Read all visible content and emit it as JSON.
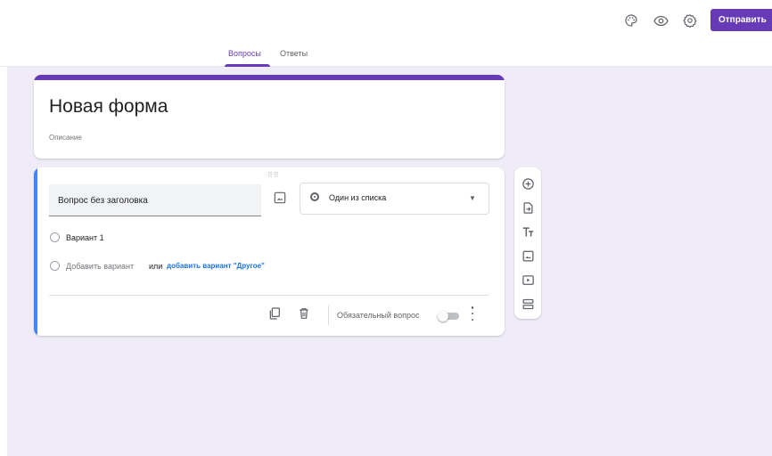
{
  "header": {
    "icons": [
      "palette-icon",
      "eye-icon",
      "gear-icon"
    ],
    "send_label": "Отправить"
  },
  "tabs": [
    {
      "label": "Вопросы",
      "active": true
    },
    {
      "label": "Ответы",
      "active": false
    }
  ],
  "form": {
    "title": "Новая форма",
    "description_placeholder": "Описание"
  },
  "question": {
    "title": "Вопрос без заголовка",
    "type": "Один из списка",
    "options": [
      {
        "label": "Вариант 1"
      }
    ],
    "add_option": "Добавить вариант",
    "or_word": "или",
    "add_other": "добавить вариант \"Другое\"",
    "required_label": "Обязательный вопрос",
    "required": false
  },
  "toolbar": {
    "tools": [
      "add-question-icon",
      "import-questions-icon",
      "add-title-icon",
      "add-image-icon",
      "add-video-icon",
      "add-section-icon"
    ]
  },
  "colors": {
    "accent": "#673ab7",
    "background": "#efecf8",
    "focus_bar": "#4285f4",
    "link": "#1a73e8"
  }
}
